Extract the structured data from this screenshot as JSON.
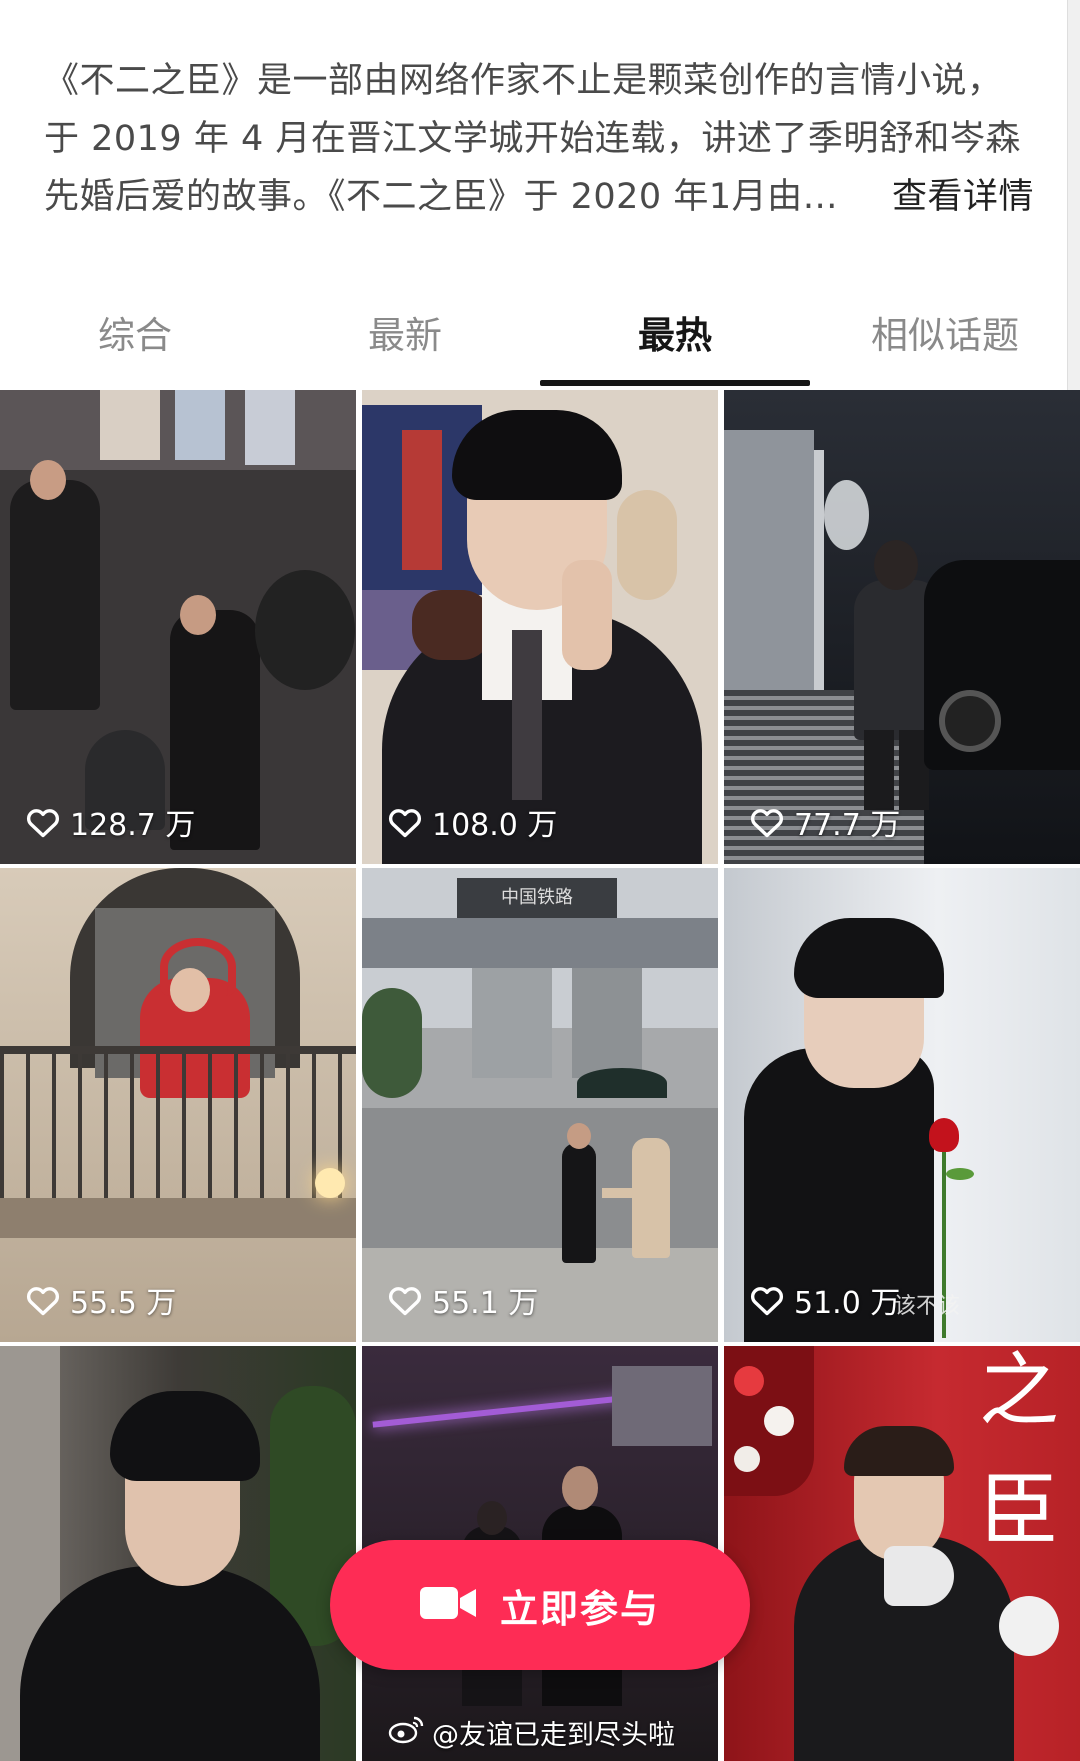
{
  "description": {
    "line1": "《不二之臣》是一部由网络作家不止是颗菜创作的言情小说，",
    "line2": "于 2019 年 4 月在晋江文学城开始连载，讲述了季明舒和岑森",
    "line3": "先婚后爱的故事。《不二之臣》于 2020 年1月由…",
    "more_label": "查看详情"
  },
  "tabs": [
    {
      "label": "综合"
    },
    {
      "label": "最新"
    },
    {
      "label": "最热"
    },
    {
      "label": "相似话题"
    }
  ],
  "active_tab": "最热",
  "videos": [
    {
      "likes": "128.7 万"
    },
    {
      "likes": "108.0 万"
    },
    {
      "likes": "77.7 万"
    },
    {
      "likes": "55.5 万"
    },
    {
      "likes": "55.1 万"
    },
    {
      "likes": "51.0 万"
    },
    {
      "likes": ""
    },
    {
      "likes": ""
    },
    {
      "likes": ""
    }
  ],
  "video_overlay_texts": {
    "tile6_caption": "该不该",
    "tile9_title_top": "之",
    "tile9_title_bottom": "臣",
    "tile5_sign": "中国铁路"
  },
  "cta": {
    "label": "立即参与",
    "icon": "video-camera-icon"
  },
  "watermark": {
    "text": "@友谊已走到尽头啦",
    "icon": "weibo-icon"
  },
  "colors": {
    "accent": "#fe2c55",
    "active_tab": "#161616",
    "inactive_tab": "#8a8a8a"
  }
}
